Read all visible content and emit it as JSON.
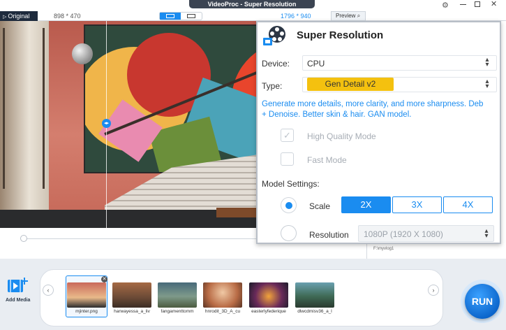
{
  "window": {
    "title": "VideoProc  -  Super Resolution"
  },
  "preview": {
    "original_tab": "Original",
    "original_dims": "898 * 470",
    "output_dims": "1796 * 940",
    "preview_label": "Preview"
  },
  "super_resolution": {
    "title": "Super Resolution",
    "device_label": "Device:",
    "device_value": "CPU",
    "type_label": "Type:",
    "type_value": "Gen Detail v2",
    "description_line1": "Generate more details, more clarity, and more sharpness. Deb",
    "description_line2": "+ Denoise. Better skin & hair. GAN model.",
    "high_quality_label": "High Quality Mode",
    "fast_mode_label": "Fast Mode",
    "model_settings_label": "Model Settings:",
    "scale_label": "Scale",
    "scale_options": [
      "2X",
      "3X",
      "4X"
    ],
    "scale_selected": "2X",
    "resolution_label": "Resolution",
    "resolution_value": "1080P (1920 X 1080)"
  },
  "output_path": "F:\\myvlog1",
  "media": {
    "add_label": "Add Media",
    "items": [
      {
        "name": "mjinter.png"
      },
      {
        "name": "harwayessa_a_liv"
      },
      {
        "name": "fangamenttomm"
      },
      {
        "name": "hnrodit_3D_A_cu"
      },
      {
        "name": "easterlyfederique"
      },
      {
        "name": "dlwcdmisv36_a_l"
      }
    ]
  },
  "run_label": "RUN",
  "colors": {
    "accent": "#1a8cf0",
    "type_highlight": "#f4c10f",
    "title_bar": "#3b4452"
  }
}
